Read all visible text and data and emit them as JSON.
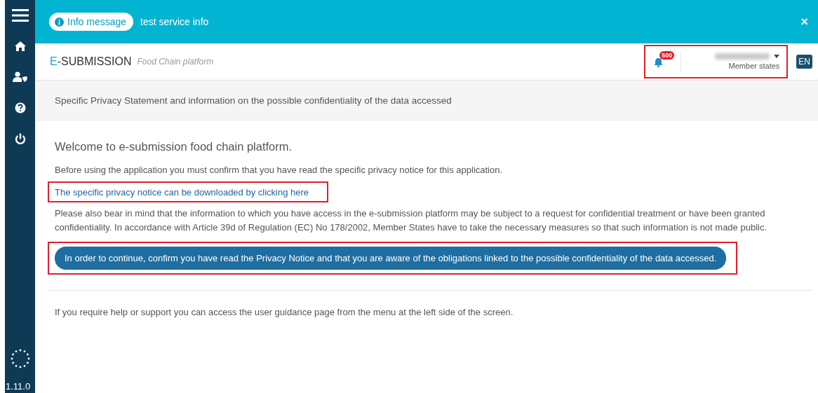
{
  "sidebar": {
    "items": [
      {
        "kind": "menu"
      },
      {
        "kind": "home"
      },
      {
        "kind": "user-shield"
      },
      {
        "kind": "help"
      },
      {
        "kind": "power"
      }
    ],
    "version": "1.11.0"
  },
  "info_bar": {
    "badge": "Info message",
    "message": "test service info",
    "close": "×"
  },
  "header": {
    "brand": "E-SUBMISSION",
    "subtitle": "Food Chain platform",
    "notifications": {
      "count": "500"
    },
    "user": {
      "role": "Member states"
    },
    "language": "EN",
    "highlighted": true
  },
  "page_title": "Specific Privacy Statement and information on the possible confidentiality of the data accessed",
  "content": {
    "heading": "Welcome to e-submission food chain platform.",
    "intro": "Before using the application you must confirm that you have read the specific privacy notice for this application.",
    "link": {
      "text": "The specific privacy notice can be downloaded by clicking here",
      "highlighted": true
    },
    "notice": "Please also bear in mind that the information to which you have access in the e-submission platform may be subject to a request for confidential treatment or have been granted confidentiality. In accordance with Article 39d of Regulation (EC) No 178/2002, Member States have to take the necessary measures so that such information is not made public.",
    "confirm_button": {
      "label": "In order to continue, confirm you have read the Privacy Notice and that you are aware of the obligations linked to the possible confidentiality of the data accessed.",
      "highlighted": true
    },
    "help": "If you require help or support you can access the user guidance page from the menu at the left side of the screen."
  }
}
